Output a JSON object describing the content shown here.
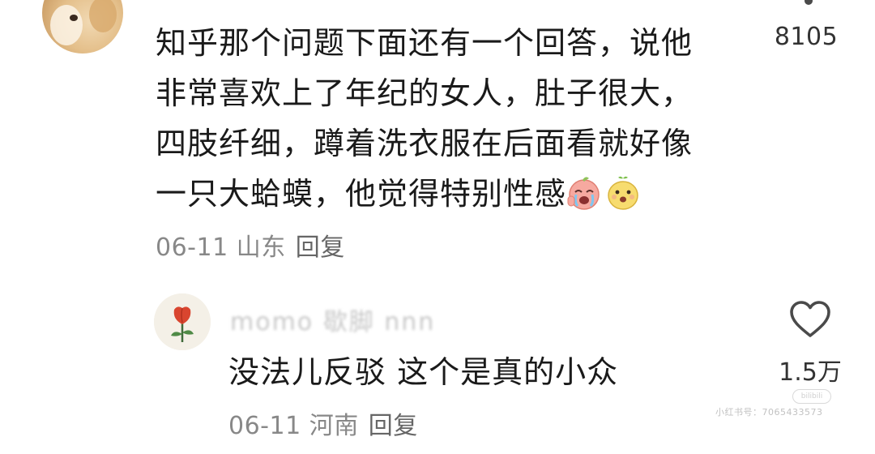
{
  "comment": {
    "text": "知乎那个问题下面还有一个回答，说他非常喜欢上了年纪的女人，肚子很大，四肢纤细，蹲着洗衣服在后面看就好像一只大蛤蟆，他觉得特别性感",
    "emojis": [
      "crying-laughing-emoji",
      "happy-sprout-emoji"
    ],
    "likes": "8105",
    "date": "06-11",
    "location": "山东",
    "reply_label": "回复"
  },
  "reply": {
    "username": "momo 歇脚 nnn",
    "text": "没法儿反驳 这个是真的小众",
    "likes": "1.5万",
    "date": "06-11",
    "location": "河南",
    "reply_label": "回复"
  },
  "watermark": {
    "badge": "bilibili",
    "text": "小红书号：7065433573"
  },
  "colors": {
    "text_primary": "#1a1a1a",
    "text_meta": "#888888",
    "icon": "#4a4a4a"
  }
}
